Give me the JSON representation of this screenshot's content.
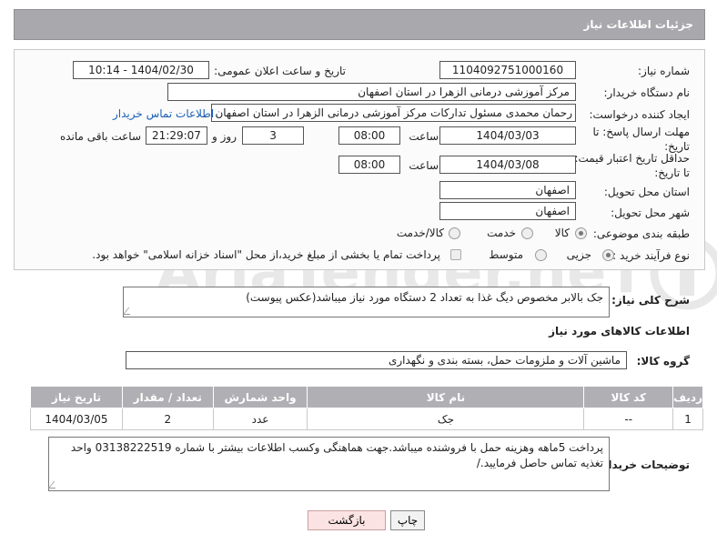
{
  "header": {
    "title": "جزئیات اطلاعات نیاز"
  },
  "form": {
    "need_number_label": "شماره نیاز:",
    "need_number": "1104092751000160",
    "announce_label": "تاریخ و ساعت اعلان عمومی:",
    "announce_value": "1404/02/30 - 10:14",
    "buyer_org_label": "نام دستگاه خریدار:",
    "buyer_org": "مرکز آموزشی درمانی الزهرا در استان اصفهان",
    "requester_label": "ایجاد کننده درخواست:",
    "requester": "رحمان محمدی مسئول تدارکات مرکز آموزشی درمانی الزهرا در استان اصفهان",
    "contact_link": "اطلاعات تماس خریدار",
    "deadline_label": "مهلت ارسال پاسخ: تا تاریخ:",
    "deadline_date": "1404/03/03",
    "time_label": "ساعت",
    "deadline_time": "08:00",
    "days_value": "3",
    "days_label": "روز و",
    "remaining_time": "21:29:07",
    "remaining_label": "ساعت باقی مانده",
    "price_validity_label": "حداقل تاریخ اعتبار قیمت: تا تاریخ:",
    "price_validity_date": "1404/03/08",
    "price_validity_time": "08:00",
    "province_label": "استان محل تحویل:",
    "province": "اصفهان",
    "city_label": "شهر محل تحویل:",
    "city": "اصفهان",
    "category_label": "طبقه بندی موضوعی:",
    "category_options": [
      "کالا",
      "خدمت",
      "کالا/خدمت"
    ],
    "process_label": "نوع فرآیند خرید :",
    "process_options": [
      "جزیی",
      "متوسط"
    ],
    "treasury_note": "پرداخت تمام یا بخشی از مبلغ خرید،از محل \"اسناد خزانه اسلامی\" خواهد بود."
  },
  "description": {
    "label": "شرح کلی نیاز:",
    "text": "جک بالابر مخصوص دیگ غذا به تعداد 2 دستگاه مورد نیاز میباشد(عکس پیوست)"
  },
  "goods": {
    "title": "اطلاعات کالاهای مورد نیاز",
    "group_label": "گروه کالا:",
    "group_value": "ماشین آلات و ملزومات حمل، بسته بندی و نگهداری",
    "columns": [
      "ردیف",
      "کد کالا",
      "نام کالا",
      "واحد شمارش",
      "تعداد / مقدار",
      "تاریخ نیاز"
    ],
    "rows": [
      [
        "1",
        "--",
        "جک",
        "عدد",
        "2",
        "1404/03/05"
      ]
    ]
  },
  "buyer_notes": {
    "label": "توضیحات خریدار:",
    "text": "پرداخت 5ماهه وهزینه حمل با فروشنده میباشد.جهت هماهنگی وکسب اطلاعات بیشتر با شماره 03138222519 واحد تغذیه تماس حاصل فرمایید./"
  },
  "buttons": {
    "print": "چاپ",
    "back": "بازگشت"
  },
  "watermark_text": "AriaTender.neT"
}
